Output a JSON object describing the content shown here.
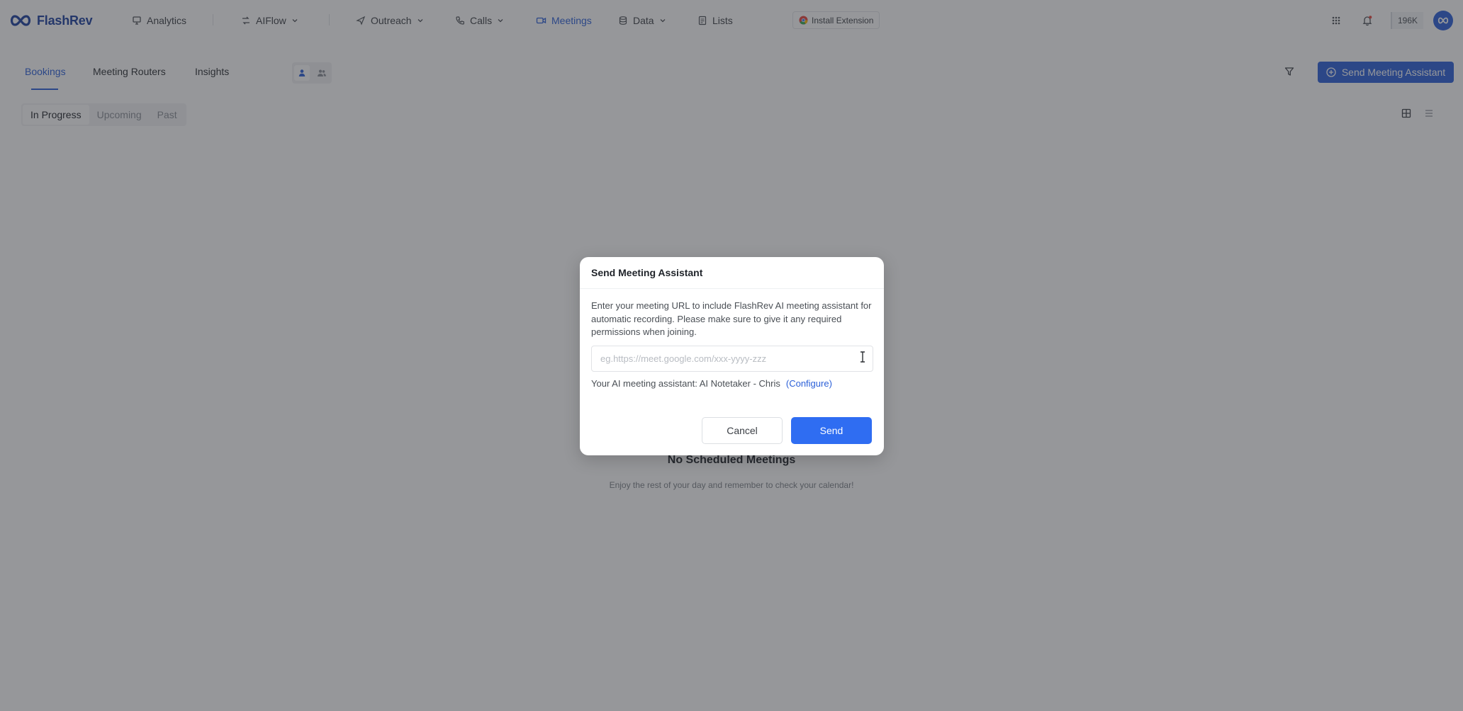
{
  "app": {
    "name": "FlashRev",
    "brand_color": "#2a5fd8"
  },
  "topnav": {
    "items": [
      {
        "label": "Analytics",
        "icon": "monitor-icon"
      },
      {
        "label": "AIFlow",
        "icon": "flow-icon",
        "has_dropdown": true
      },
      {
        "label": "Outreach",
        "icon": "send-icon",
        "has_dropdown": true
      },
      {
        "label": "Calls",
        "icon": "phone-icon",
        "has_dropdown": true
      },
      {
        "label": "Meetings",
        "icon": "video-icon",
        "active": true
      },
      {
        "label": "Data",
        "icon": "database-icon",
        "has_dropdown": true
      },
      {
        "label": "Lists",
        "icon": "list-icon"
      }
    ],
    "install_extension": "Install Extension",
    "credits": "196K"
  },
  "subnav": {
    "tabs": [
      "Bookings",
      "Meeting Routers",
      "Insights"
    ],
    "active_tab": "Bookings",
    "send_button": "Send Meeting Assistant"
  },
  "status_filter": {
    "options": [
      "In Progress",
      "Upcoming",
      "Past"
    ],
    "selected": "In Progress"
  },
  "empty_state": {
    "title": "No Scheduled Meetings",
    "subtitle": "Enjoy the rest of your day and remember to check your calendar!"
  },
  "modal": {
    "title": "Send Meeting Assistant",
    "description": "Enter your meeting URL to include FlashRev AI meeting assistant for automatic recording. Please make sure to give it any required permissions when joining.",
    "url_input": {
      "value": "",
      "placeholder": "eg.https://meet.google.com/xxx-yyyy-zzz"
    },
    "assistant_label": "Your AI meeting assistant: AI Notetaker - Chris",
    "configure_link": "(Configure)",
    "cancel_label": "Cancel",
    "send_label": "Send"
  }
}
